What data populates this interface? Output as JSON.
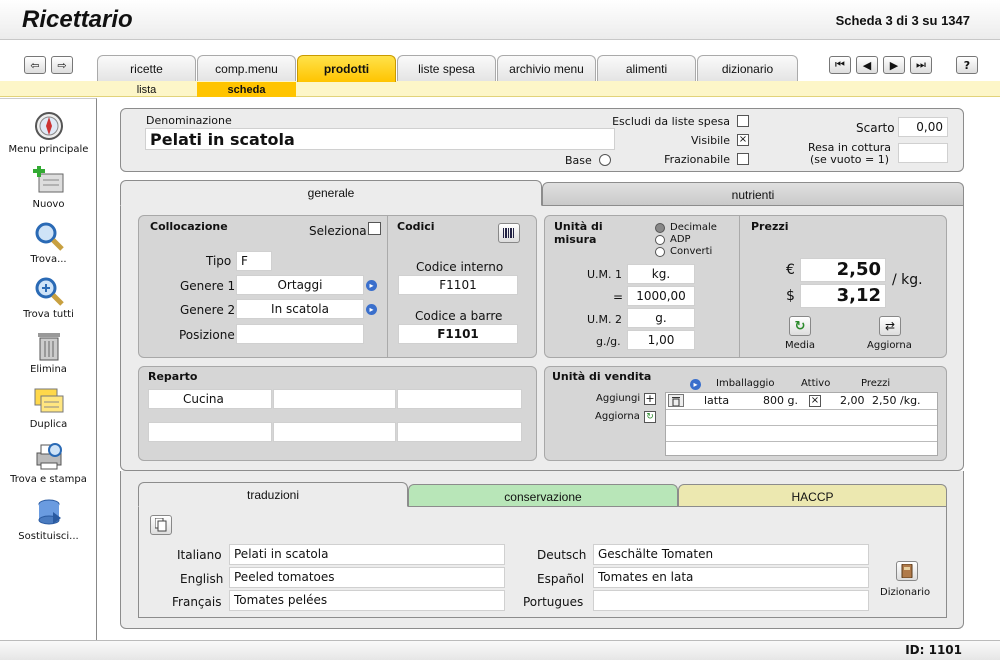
{
  "header": {
    "app_title": "Ricettario",
    "record_count": "Scheda 3 di 3 su 1347"
  },
  "tabs": [
    {
      "label": "ricette"
    },
    {
      "label": "comp.menu"
    },
    {
      "label": "prodotti"
    },
    {
      "label": "liste spesa"
    },
    {
      "label": "archivio menu"
    },
    {
      "label": "alimenti"
    },
    {
      "label": "dizionario"
    }
  ],
  "subtabs": [
    {
      "label": "lista"
    },
    {
      "label": "scheda"
    }
  ],
  "nav": {
    "help": "?"
  },
  "sidebar": [
    {
      "label": "Menu principale",
      "icon": "compass-icon"
    },
    {
      "label": "Nuovo",
      "icon": "new-record-icon"
    },
    {
      "label": "Trova...",
      "icon": "magnifier-icon"
    },
    {
      "label": "Trova tutti",
      "icon": "magnifier-plus-icon"
    },
    {
      "label": "Elimina",
      "icon": "trash-icon"
    },
    {
      "label": "Duplica",
      "icon": "duplicate-icon"
    },
    {
      "label": "Trova e stampa",
      "icon": "print-icon"
    },
    {
      "label": "Sostituisci...",
      "icon": "replace-icon"
    }
  ],
  "product": {
    "denominazione_label": "Denominazione",
    "denominazione": "Pelati in scatola",
    "base_label": "Base",
    "escludi_label": "Escludi da liste spesa",
    "visibile_label": "Visibile",
    "visibile_mark": "×",
    "frazionabile_label": "Frazionabile",
    "scarto_label": "Scarto",
    "scarto": "0,00",
    "resa_label1": "Resa in cottura",
    "resa_label2": "(se vuoto = 1)",
    "resa": ""
  },
  "panel_tabs": {
    "generale": "generale",
    "nutrienti": "nutrienti"
  },
  "collocazione": {
    "title": "Collocazione",
    "seleziona": "Seleziona",
    "tipo_label": "Tipo",
    "tipo": "F",
    "genere1_label": "Genere 1",
    "genere1": "Ortaggi",
    "genere2_label": "Genere 2",
    "genere2": "In scatola",
    "posizione_label": "Posizione",
    "posizione": ""
  },
  "codici": {
    "title": "Codici",
    "interno_label": "Codice interno",
    "interno": "F1101",
    "barre_label": "Codice a barre",
    "barre": "F1101"
  },
  "unita": {
    "title1": "Unità di",
    "title2": "misura",
    "opt1": "Decimale",
    "opt2": "ADP",
    "opt3": "Converti",
    "um1_label": "U.M. 1",
    "um1": "kg.",
    "eq_label": "=",
    "eq": "1000,00",
    "um2_label": "U.M. 2",
    "um2": "g.",
    "gg_label": "g./g.",
    "gg": "1,00"
  },
  "prezzi": {
    "title": "Prezzi",
    "eur_sym": "€",
    "eur": "2,50",
    "usd_sym": "$",
    "usd": "3,12",
    "per": "/ kg.",
    "media": "Media",
    "aggiorna": "Aggiorna"
  },
  "reparto": {
    "title": "Reparto",
    "cells": [
      "Cucina",
      "",
      "",
      "",
      "",
      ""
    ]
  },
  "vendita": {
    "title": "Unità di vendita",
    "col_imballaggio": "Imballaggio",
    "col_attivo": "Attivo",
    "col_prezzi": "Prezzi",
    "aggiungi": "Aggiungi",
    "aggiorna": "Aggiorna",
    "row": {
      "imballaggio": "latta",
      "qty": "800 g.",
      "attivo": "×",
      "prezzo": "2,00",
      "unit": "2,50 /kg."
    }
  },
  "bottom_tabs": {
    "traduzioni": "traduzioni",
    "conservazione": "conservazione",
    "haccp": "HACCP"
  },
  "traduzioni": {
    "italiano_label": "Italiano",
    "italiano": "Pelati in scatola",
    "english_label": "English",
    "english": "Peeled tomatoes",
    "francais_label": "Français",
    "francais": "Tomates pelées",
    "deutsch_label": "Deutsch",
    "deutsch": "Geschälte Tomaten",
    "espanol_label": "Español",
    "espanol": "Tomates en lata",
    "portugues_label": "Portugues",
    "portugues": "",
    "dizionario": "Dizionario"
  },
  "footer": {
    "id": "ID: 1101"
  },
  "colors": {
    "accent": "#ffc400",
    "conservazione": "#b8e6b8",
    "haccp": "#ece8b0"
  }
}
